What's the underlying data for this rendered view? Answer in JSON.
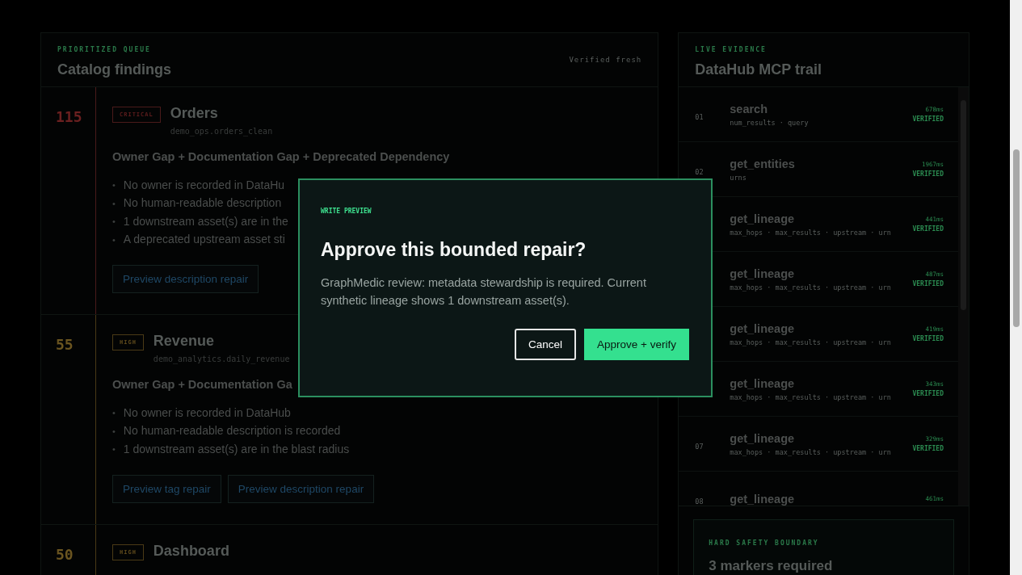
{
  "queue": {
    "eyebrow": "PRIORITIZED QUEUE",
    "title": "Catalog findings",
    "status": "Verified fresh",
    "bullet": "•",
    "findings": [
      {
        "score": "115",
        "kind": "critical",
        "severity": "CRITICAL",
        "name": "Orders",
        "table": "demo_ops.orders_clean",
        "title": "Owner Gap + Documentation Gap + Deprecated Dependency",
        "issues": [
          "No owner is recorded in DataHu",
          "No human-readable description",
          "1 downstream asset(s) are in the",
          "A deprecated upstream asset sti"
        ],
        "actions": [
          "Preview description repair"
        ]
      },
      {
        "score": "55",
        "kind": "high",
        "severity": "HIGH",
        "name": "Revenue",
        "table": "demo_analytics.daily_revenue",
        "title": "Owner Gap + Documentation Ga",
        "issues": [
          "No owner is recorded in DataHub",
          "No human-readable description is recorded",
          "1 downstream asset(s) are in the blast radius"
        ],
        "actions": [
          "Preview tag repair",
          "Preview description repair"
        ]
      },
      {
        "score": "50",
        "kind": "high",
        "severity": "HIGH",
        "name": "Dashboard"
      }
    ]
  },
  "trail": {
    "eyebrow": "LIVE EVIDENCE",
    "title": "DataHub MCP trail",
    "calls": [
      {
        "number": "01",
        "tool": "search",
        "args": "num_results · query",
        "duration": "678ms",
        "status": "VERIFIED"
      },
      {
        "number": "02",
        "tool": "get_entities",
        "args": "urns",
        "duration": "1967ms",
        "status": "VERIFIED"
      },
      {
        "tool": "get_lineage",
        "args": "max_hops · max_results · upstream · urn",
        "duration": "441ms",
        "status": "VERIFIED"
      },
      {
        "tool": "get_lineage",
        "args": "max_hops · max_results · upstream · urn",
        "duration": "487ms",
        "status": "VERIFIED"
      },
      {
        "tool": "get_lineage",
        "args": "max_hops · max_results · upstream · urn",
        "duration": "419ms",
        "status": "VERIFIED"
      },
      {
        "tool": "get_lineage",
        "args": "max_hops · max_results · upstream · urn",
        "duration": "343ms",
        "status": "VERIFIED"
      },
      {
        "number": "07",
        "tool": "get_lineage",
        "args": "max_hops · max_results · upstream · urn",
        "duration": "329ms",
        "status": "VERIFIED"
      },
      {
        "number": "08",
        "tool": "get_lineage",
        "duration": "461ms"
      }
    ],
    "boundary": {
      "eyebrow": "HARD SAFETY BOUNDARY",
      "title": "3 markers required"
    }
  },
  "dialog": {
    "eyebrow": "WRITE PREVIEW",
    "title": "Approve this bounded repair?",
    "body": "GraphMedic review: metadata stewardship is required. Current synthetic lineage shows 1 downstream asset(s).",
    "buttons": [
      {
        "label": "Cancel",
        "kind": "secondary"
      },
      {
        "label": "Approve + verify",
        "kind": "primary"
      }
    ]
  }
}
